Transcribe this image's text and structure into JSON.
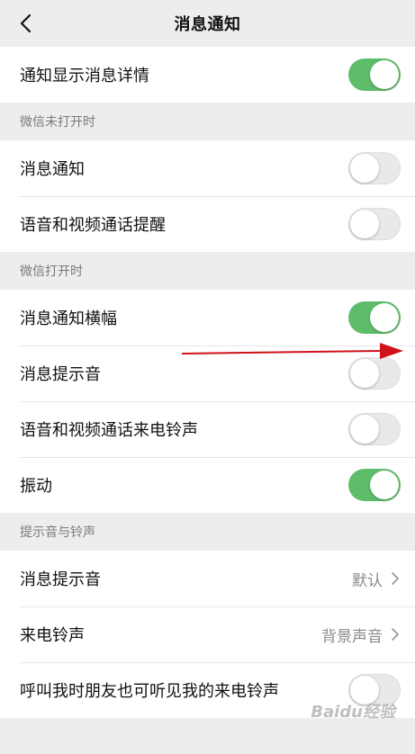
{
  "header": {
    "title": "消息通知"
  },
  "rows": {
    "show_details": {
      "label": "通知显示消息详情",
      "on": true
    }
  },
  "sections": {
    "closed": {
      "title": "微信未打开时",
      "items": [
        {
          "label": "消息通知",
          "on": false
        },
        {
          "label": "语音和视频通话提醒",
          "on": false
        }
      ]
    },
    "open": {
      "title": "微信打开时",
      "items": [
        {
          "label": "消息通知横幅",
          "on": true
        },
        {
          "label": "消息提示音",
          "on": false
        },
        {
          "label": "语音和视频通话来电铃声",
          "on": false
        },
        {
          "label": "振动",
          "on": true
        }
      ]
    },
    "sounds": {
      "title": "提示音与铃声",
      "message_sound": {
        "label": "消息提示音",
        "value": "默认"
      },
      "ringtone": {
        "label": "来电铃声",
        "value": "背景声音"
      },
      "friends_hear": {
        "label": "呼叫我时朋友也可听见我的来电铃声",
        "on": false
      }
    }
  },
  "annotation": {
    "arrow_color": "#d0101a"
  },
  "colors": {
    "toggle_on": "#5ebd6a",
    "toggle_off": "#e9e9e9",
    "background": "#ededed"
  },
  "watermark": "Baidu经验"
}
